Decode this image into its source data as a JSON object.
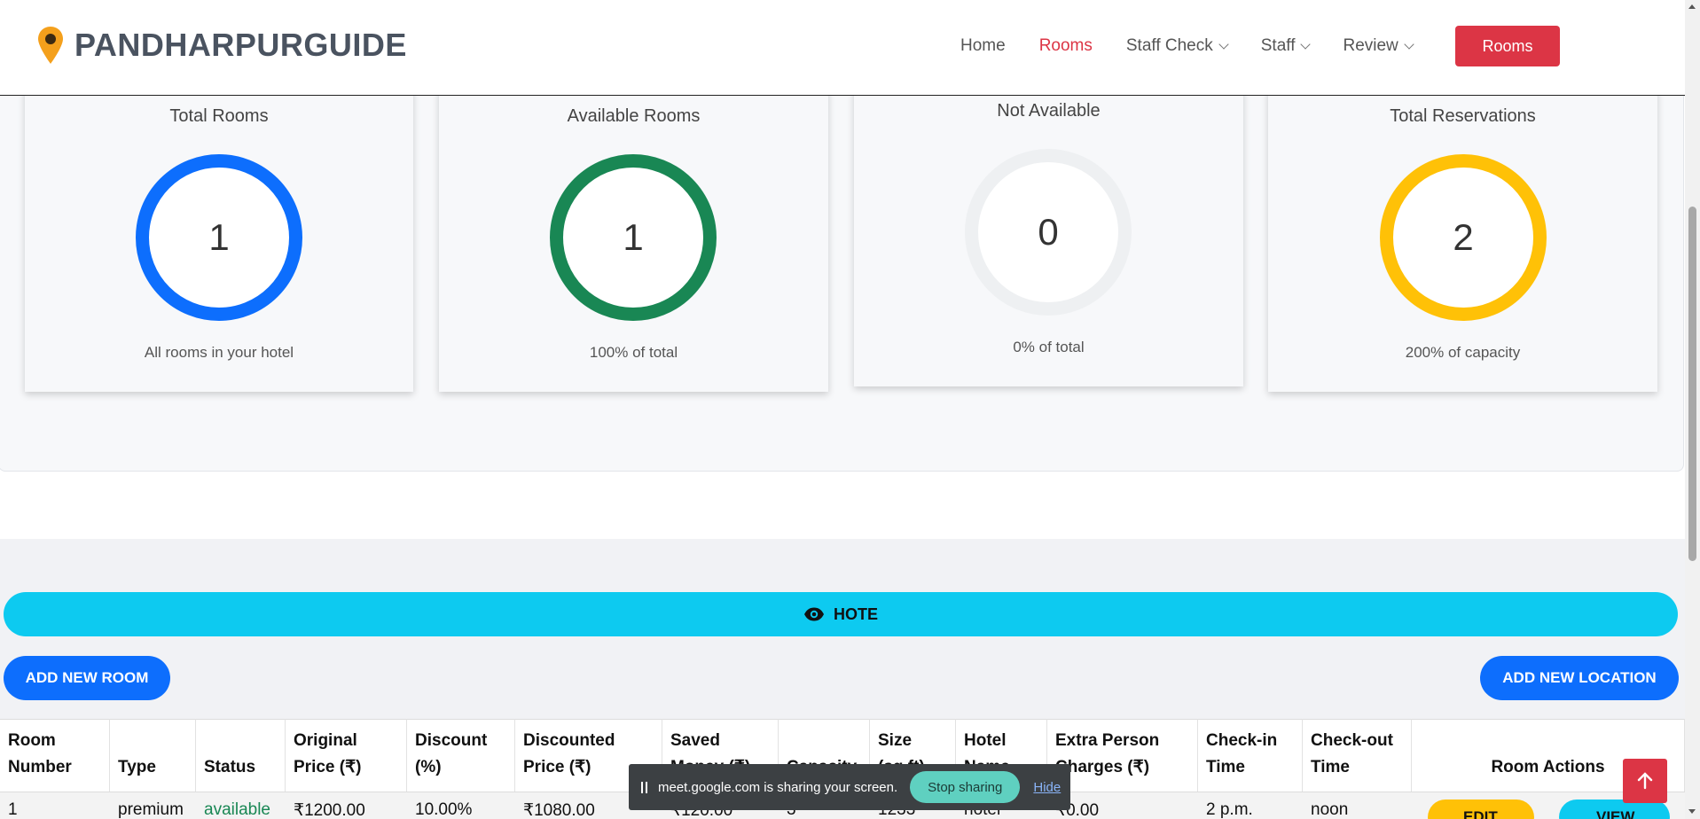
{
  "nav": {
    "brand": "PANDHARPURGUIDE",
    "links": [
      "Home",
      "Rooms",
      "Staff Check",
      "Staff",
      "Review"
    ],
    "button": "Rooms"
  },
  "stats": [
    {
      "title": "Total Rooms",
      "value": "1",
      "subtitle": "All rooms in your hotel",
      "color": "#0d6efd"
    },
    {
      "title": "Available Rooms",
      "value": "1",
      "subtitle": "100% of total",
      "color": "#198754"
    },
    {
      "title": "Not Available",
      "value": "0",
      "subtitle": "0% of total",
      "color": "#eef0f2"
    },
    {
      "title": "Total Reservations",
      "value": "2",
      "subtitle": "200% of capacity",
      "color": "#ffc107"
    }
  ],
  "hotel_button": "HOTE",
  "add_room": "ADD NEW ROOM",
  "add_location": "ADD NEW LOCATION",
  "table": {
    "headers": [
      [
        "Room",
        "Number"
      ],
      [
        "",
        "Type"
      ],
      [
        "",
        "Status"
      ],
      [
        "Original",
        "Price (₹)"
      ],
      [
        "Discount",
        "(%)"
      ],
      [
        "Discounted",
        "Price (₹)"
      ],
      [
        "Saved",
        "Money (₹)"
      ],
      [
        "",
        "Capacity"
      ],
      [
        "Size",
        "(sq.ft)"
      ],
      [
        "Hotel",
        "Name"
      ],
      [
        "Extra Person",
        "Charges (₹)"
      ],
      [
        "Check-in",
        "Time"
      ],
      [
        "Check-out",
        "Time"
      ],
      [
        "",
        "Room Actions"
      ]
    ],
    "row": [
      "1",
      "premium",
      "available",
      "₹1200.00",
      "10.00%",
      "₹1080.00",
      "₹120.00",
      "3",
      "1233",
      "hotel",
      "₹0.00",
      "2 p.m.",
      "noon"
    ],
    "edit": "EDIT",
    "view": "VIEW"
  },
  "share_bar": {
    "message": "meet.google.com is sharing your screen.",
    "stop": "Stop sharing",
    "hide": "Hide"
  }
}
